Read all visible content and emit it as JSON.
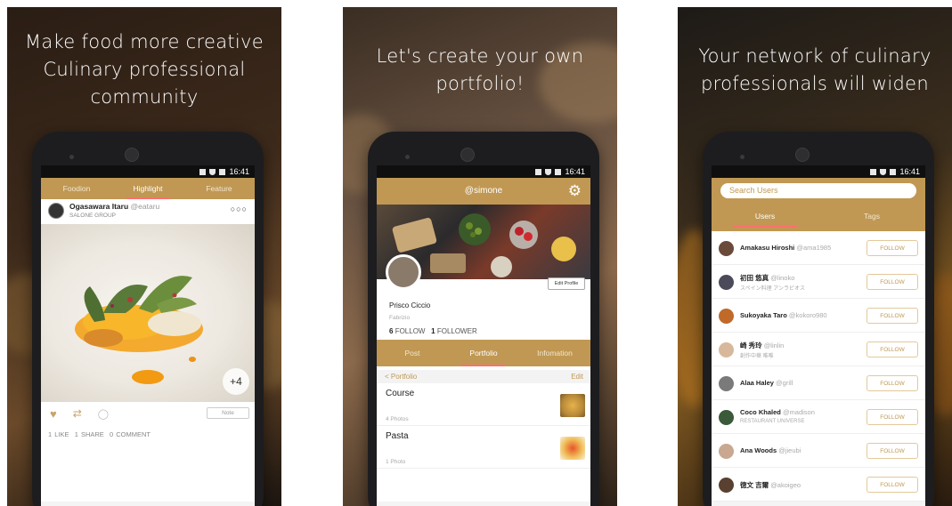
{
  "status": {
    "time": "16:41"
  },
  "panel1": {
    "headline": [
      "Make food more creative",
      "Culinary professional",
      "community"
    ],
    "tabs": [
      "Foodion",
      "Highlight",
      "Feature"
    ],
    "post": {
      "author": "Ogasawara Itaru",
      "handle": "@eataru",
      "group": "SALONE GROUP",
      "more": "+4",
      "note_label": "Note",
      "likes": "1 LIKE",
      "shares": "1 SHARE",
      "comments": "0 COMMENT"
    },
    "nav_logo": "F"
  },
  "panel2": {
    "headline": [
      "Let's create your own",
      "portfolio!"
    ],
    "title": "@simone",
    "edit_profile": "Edit Profile",
    "name": "Prisco Ciccio",
    "subname": "Fabrizio",
    "follow_count": "6",
    "follow_label": "FOLLOW",
    "follower_count": "1",
    "follower_label": "FOLLOWER",
    "tabs": [
      "Post",
      "Portfolio",
      "Infomation"
    ],
    "section": "< Portfolio",
    "section_edit": "Edit",
    "albums": [
      {
        "title": "Course",
        "count": "4 Photos"
      },
      {
        "title": "Pasta",
        "count": "1 Photo"
      }
    ]
  },
  "panel3": {
    "headline": [
      "Your network of culinary",
      "professionals will widen"
    ],
    "search_placeholder": "Search Users",
    "tabs": [
      "Users",
      "Tags"
    ],
    "follow_label": "FOLLOW",
    "users": [
      {
        "name": "Amakasu Hiroshi",
        "handle": "@ama1985",
        "sub": ""
      },
      {
        "name": "初田 悠真",
        "handle": "@linoko",
        "sub": "スペイン料理 アンラビオス"
      },
      {
        "name": "Sukoyaka Taro",
        "handle": "@kokoro980",
        "sub": ""
      },
      {
        "name": "崎 秀玲",
        "handle": "@linlin",
        "sub": "創作中華 唯唯"
      },
      {
        "name": "Alaa Haley",
        "handle": "@grill",
        "sub": ""
      },
      {
        "name": "Coco Khaled",
        "handle": "@madison",
        "sub": "RESTAURANT UNIVERSE"
      },
      {
        "name": "Ana Woods",
        "handle": "@jieubi",
        "sub": ""
      },
      {
        "name": "徳文 吉爾",
        "handle": "@akoigeo",
        "sub": ""
      }
    ]
  }
}
